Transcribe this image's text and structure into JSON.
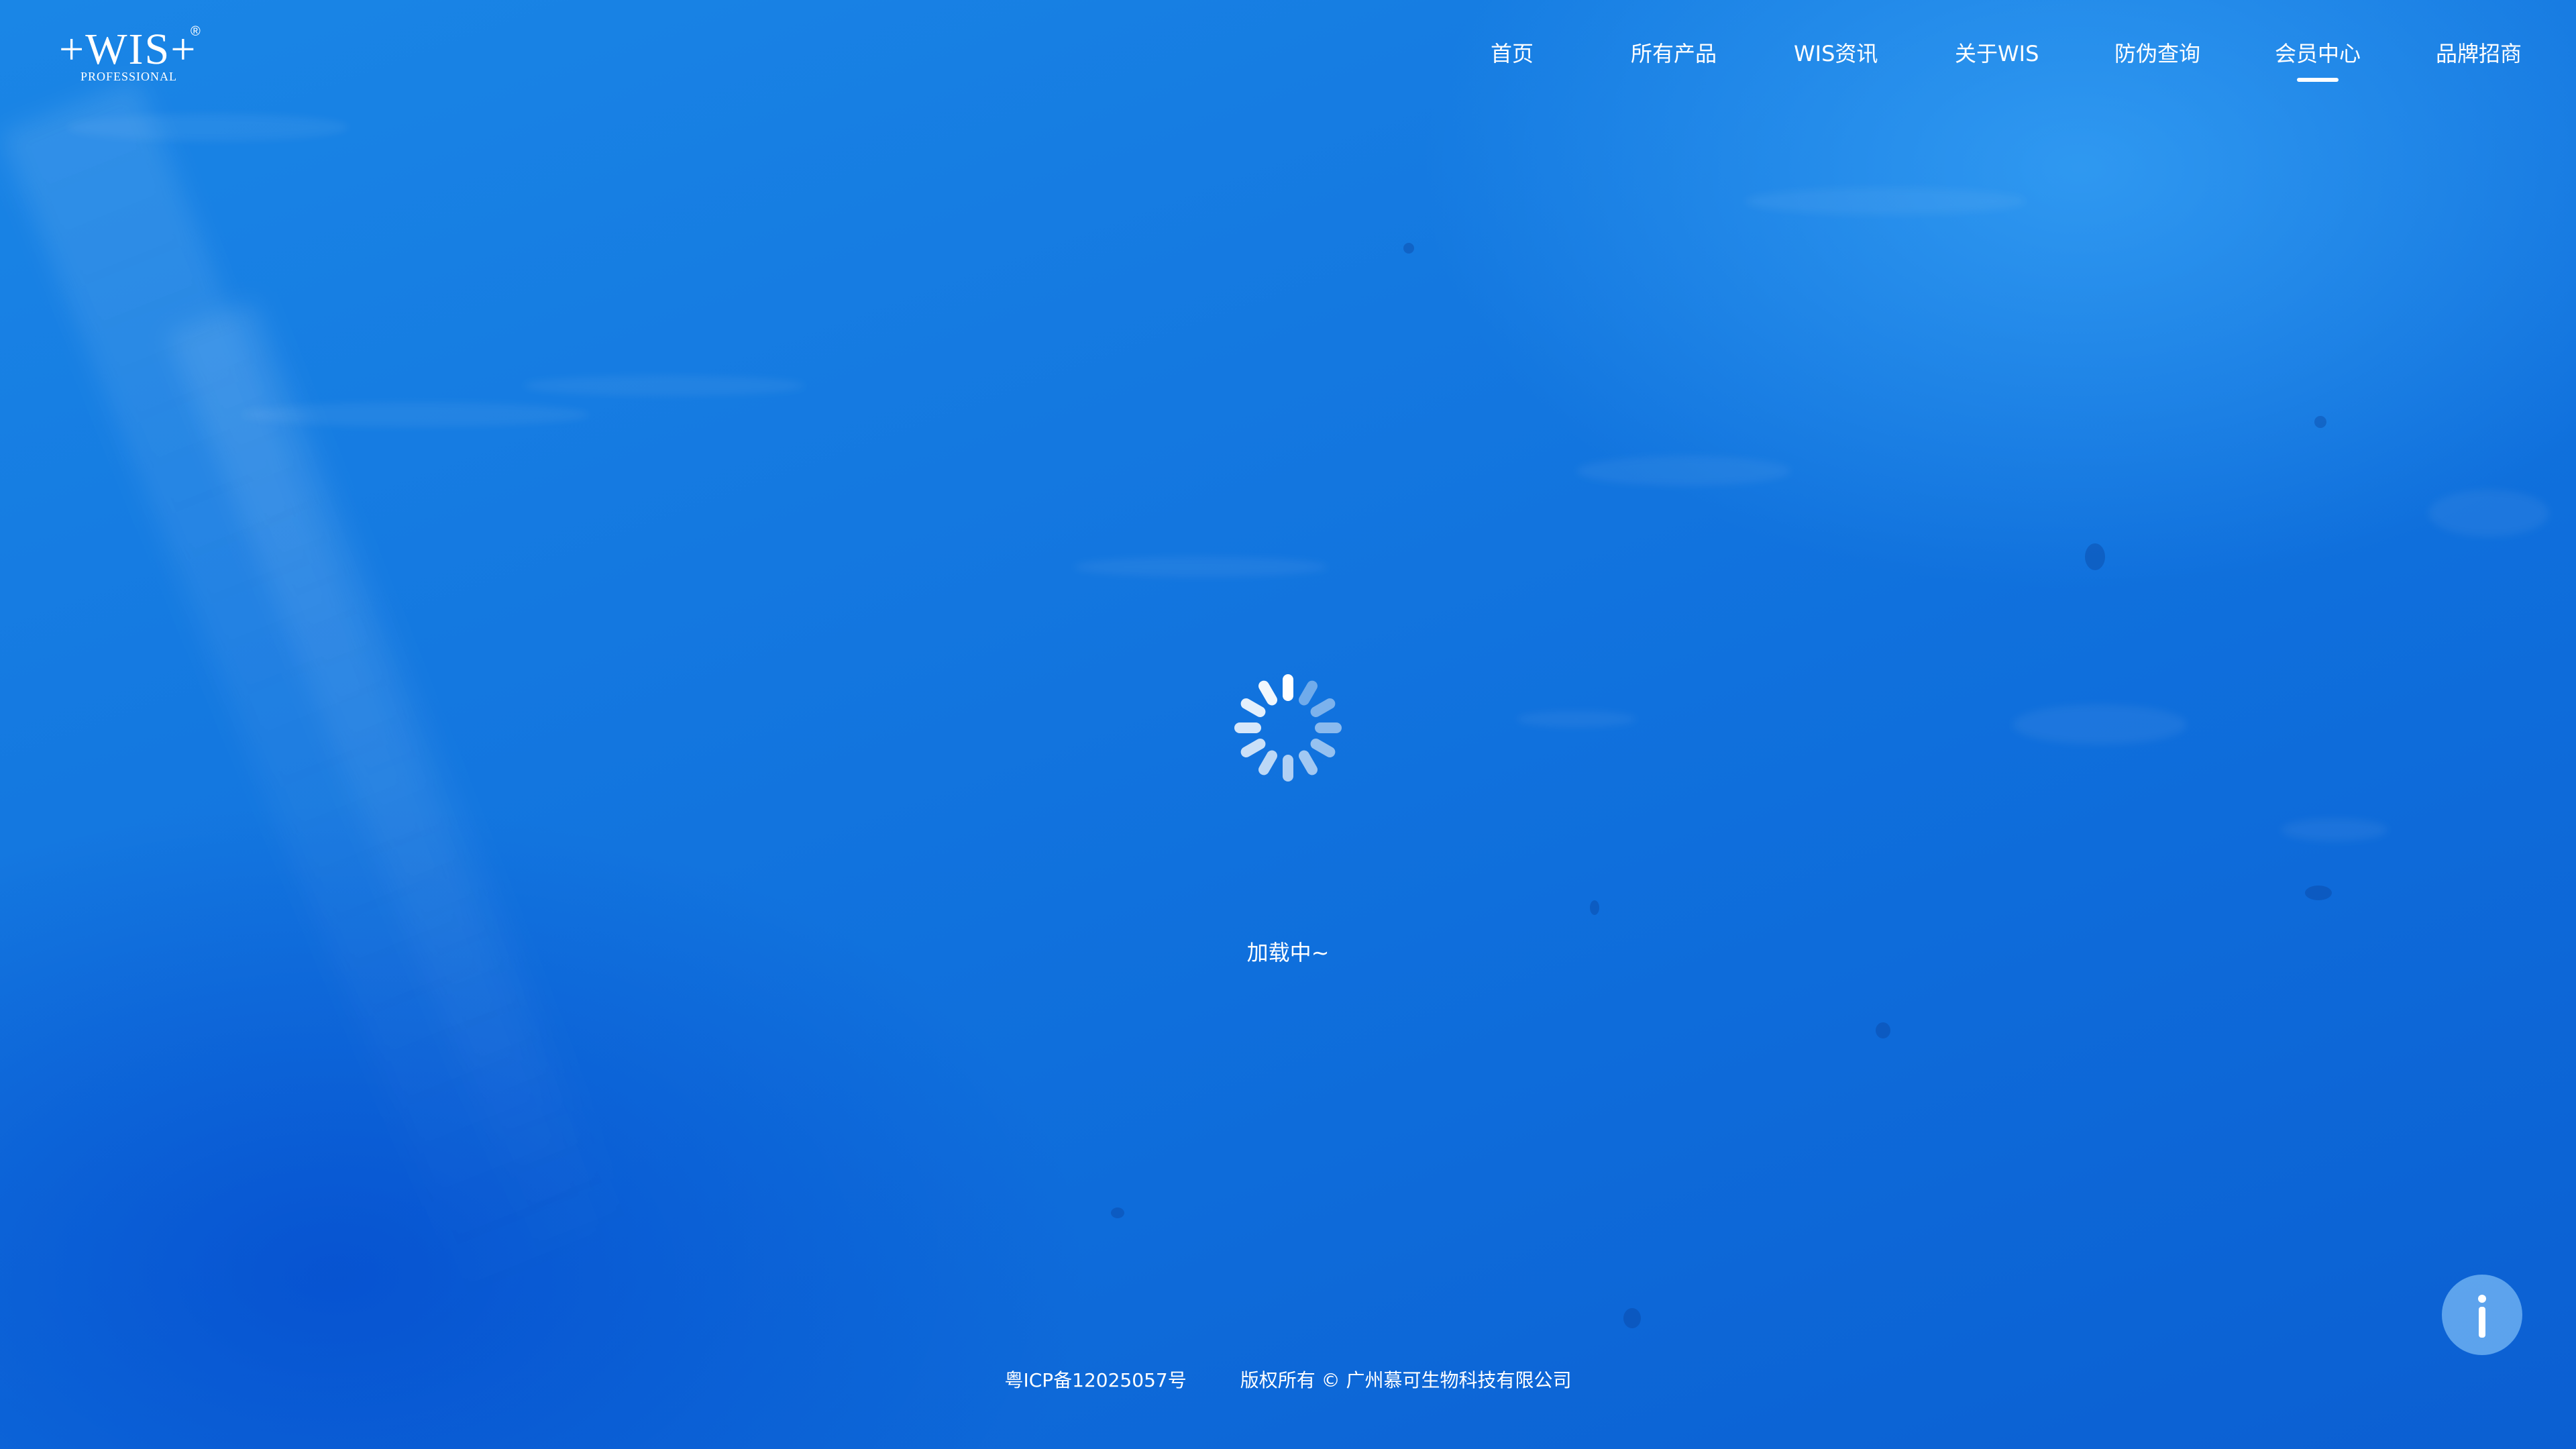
{
  "header": {
    "logo": {
      "main": "+WIS+",
      "registered": "®",
      "sub": "PROFESSIONAL"
    },
    "nav": {
      "items": [
        {
          "label": "首页"
        },
        {
          "label": "所有产品"
        },
        {
          "label": "WIS资讯"
        },
        {
          "label": "关于WIS"
        },
        {
          "label": "防伪查询"
        },
        {
          "label": "会员中心"
        },
        {
          "label": "品牌招商"
        }
      ],
      "active_label": "会员中心"
    }
  },
  "main": {
    "loading_text": "加载中~"
  },
  "footer": {
    "icp": "粤ICP备12025057号",
    "copyright": "版权所有 © 广州慕可生物科技有限公司"
  },
  "colors": {
    "background_top": "#1a86e6",
    "background_bottom": "#0b5fd2",
    "text": "#ffffff",
    "info_button": "#78b9f5"
  },
  "icons": {
    "spinner": "loading-spinner-icon",
    "info": "info-icon"
  }
}
